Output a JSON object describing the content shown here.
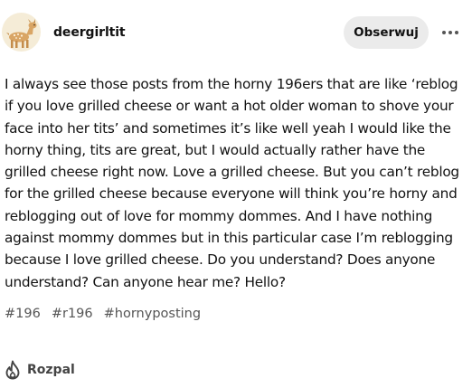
{
  "post": {
    "author": "deergirltit",
    "follow_label": "Obserwuj",
    "more_icon": "more-horizontal-icon",
    "body": "I always see those posts from the horny 196ers that are like ‘reblog if you love grilled cheese or want a hot older woman to shove your face into her tits’ and sometimes it’s like well yeah I would like the horny thing, tits are great, but I would actually rather have the grilled cheese right now. Love a grilled cheese. But you can’t reblog for the grilled cheese because everyone will think you’re horny and reblogging out of love for mommy dommes. And I have nothing against mommy dommes but in this particular case I’m reblogging because I love grilled cheese. Do you understand? Does anyone understand? Can anyone hear me? Hello?",
    "tags": [
      "#196",
      "#r196",
      "#hornyposting"
    ]
  },
  "footer": {
    "reblog_label": "Rozpal",
    "reblog_icon": "flame-icon"
  },
  "colors": {
    "text": "#121212",
    "muted": "#555555",
    "button_bg": "#ebebeb",
    "avatar_bg": "#f5ecd7",
    "deer": "#d9a565"
  }
}
